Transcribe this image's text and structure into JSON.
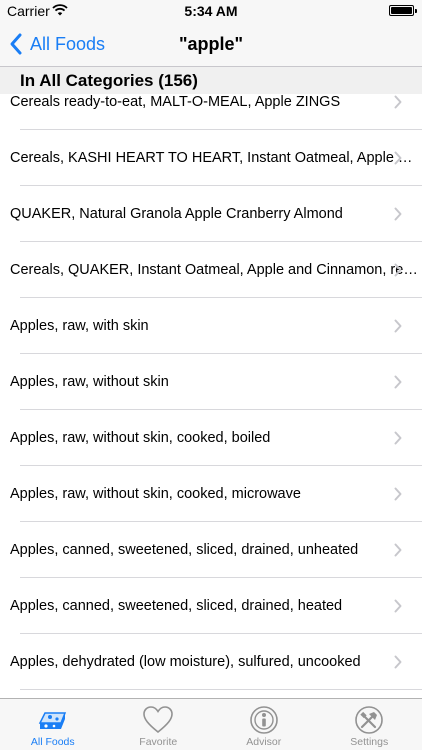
{
  "status_bar": {
    "carrier": "Carrier",
    "time": "5:34 AM",
    "battery_level": 1.0
  },
  "nav": {
    "back_label": "All Foods",
    "title": "\"apple\""
  },
  "section": {
    "header": "In All Categories (156)"
  },
  "rows": [
    {
      "label": "Cereals ready-to-eat, MALT-O-MEAL, Apple ZINGS"
    },
    {
      "label": "Cereals, KASHI HEART TO HEART, Instant Oatmeal, Apple Cinnamon"
    },
    {
      "label": "QUAKER, Natural Granola Apple Cranberry Almond"
    },
    {
      "label": "Cereals, QUAKER, Instant Oatmeal, Apple and Cinnamon, reduced sugar"
    },
    {
      "label": "Apples, raw, with skin"
    },
    {
      "label": "Apples, raw, without skin"
    },
    {
      "label": "Apples, raw, without skin, cooked, boiled"
    },
    {
      "label": "Apples, raw, without skin, cooked, microwave"
    },
    {
      "label": "Apples, canned, sweetened, sliced, drained, unheated"
    },
    {
      "label": "Apples, canned, sweetened, sliced, drained, heated"
    },
    {
      "label": "Apples, dehydrated (low moisture), sulfured, uncooked"
    }
  ],
  "tabs": [
    {
      "label": "All Foods",
      "icon": "food-icon",
      "active": true
    },
    {
      "label": "Favorite",
      "icon": "heart-icon",
      "active": false
    },
    {
      "label": "Advisor",
      "icon": "advisor-icon",
      "active": false
    },
    {
      "label": "Settings",
      "icon": "tools-icon",
      "active": false
    }
  ],
  "colors": {
    "accent": "#1a7ef5",
    "inactive": "#929292"
  }
}
